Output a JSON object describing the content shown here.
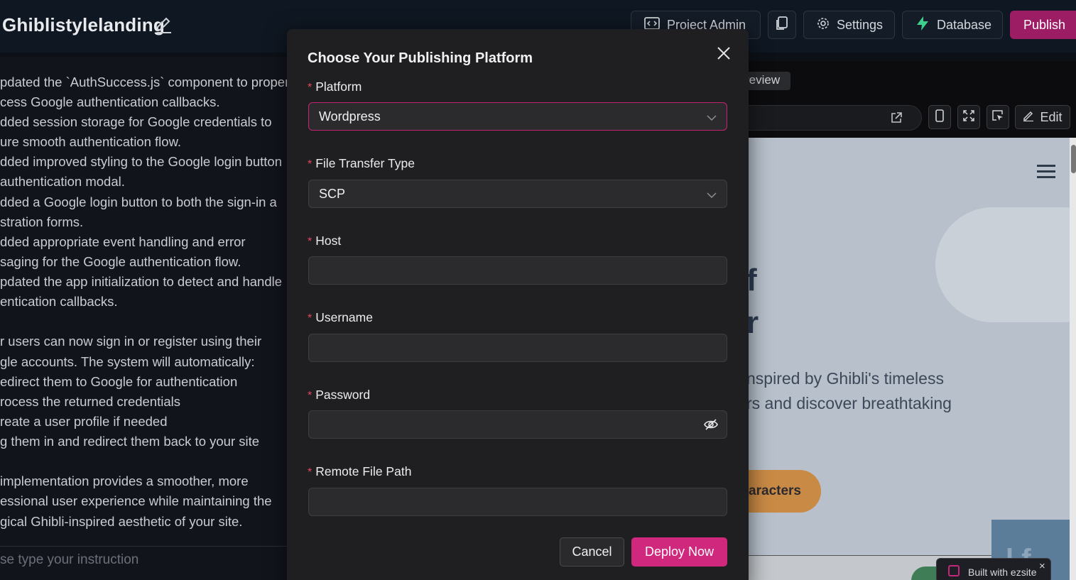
{
  "header": {
    "project_title": "Ghiblistylelanding",
    "buttons": {
      "project_admin": "Project Admin",
      "settings": "Settings",
      "database": "Database",
      "publish": "Publish"
    }
  },
  "chat": {
    "lines": [
      "pdated the `AuthSuccess.js` component to proper",
      "cess Google authentication callbacks.",
      "dded session storage for Google credentials to",
      "ure smooth authentication flow.",
      "dded improved styling to the Google login button",
      "authentication modal.",
      "dded a Google login button to both the sign-in a",
      "stration forms.",
      "dded appropriate event handling and error",
      "saging for the Google authentication flow.",
      "pdated the app initialization to detect and handle",
      "entication callbacks.",
      "r users can now sign in or register using their",
      "gle accounts. The system will automatically:",
      "edirect them to Google for authentication",
      "rocess the returned credentials",
      "reate a user profile if needed",
      "g them in and redirect them back to your site",
      "implementation provides a smoother, more",
      "essional user experience while maintaining the",
      "gical Ghibli-inspired aesthetic of your site."
    ],
    "input_placeholder": "se type your instruction"
  },
  "preview": {
    "tab_label": "review",
    "edit_label": "Edit",
    "site": {
      "heading_line1": "f",
      "heading_line2": "r",
      "text_line1": "nspired by Ghibli's timeless",
      "text_line2": "rs and discover breathtaking",
      "cta_label": "aracters",
      "card_letters": "l  f"
    },
    "badge": {
      "text": "Built with ezsite",
      "close": "×"
    }
  },
  "modal": {
    "title": "Choose Your Publishing Platform",
    "fields": {
      "platform": {
        "label": "Platform",
        "value": "Wordpress"
      },
      "transfer": {
        "label": "File Transfer Type",
        "value": "SCP"
      },
      "host": {
        "label": "Host",
        "value": ""
      },
      "username": {
        "label": "Username",
        "value": ""
      },
      "password": {
        "label": "Password",
        "value": ""
      },
      "remote_path": {
        "label": "Remote File Path",
        "value": ""
      }
    },
    "required_marker": "*",
    "cancel_label": "Cancel",
    "deploy_label": "Deploy Now"
  },
  "colors": {
    "accent": "#d0287d",
    "publish_bg": "#9c1d63",
    "required": "#e0475b"
  }
}
